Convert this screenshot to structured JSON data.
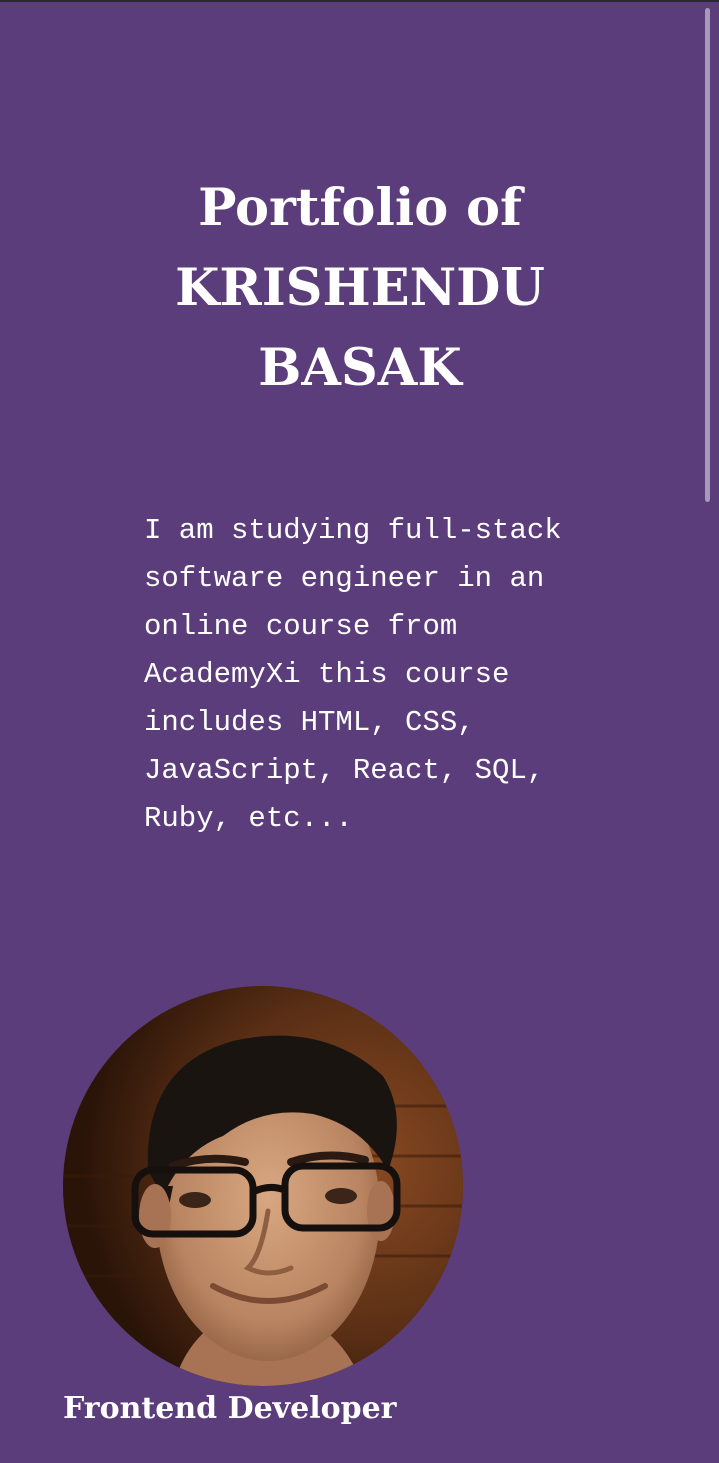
{
  "header": {
    "title_line1": "Portfolio of",
    "title_line2": "KRISHENDU",
    "title_line3": "BASAK"
  },
  "intro": {
    "text": "I am studying full-stack software engineer in an online course from AcademyXi this course includes HTML, CSS, JavaScript, React, SQL, Ruby, etc..."
  },
  "profile": {
    "role": "Frontend Developer",
    "photo_icon": "profile-photo"
  },
  "colors": {
    "background": "#5c3d7c",
    "text": "#ffffff"
  }
}
